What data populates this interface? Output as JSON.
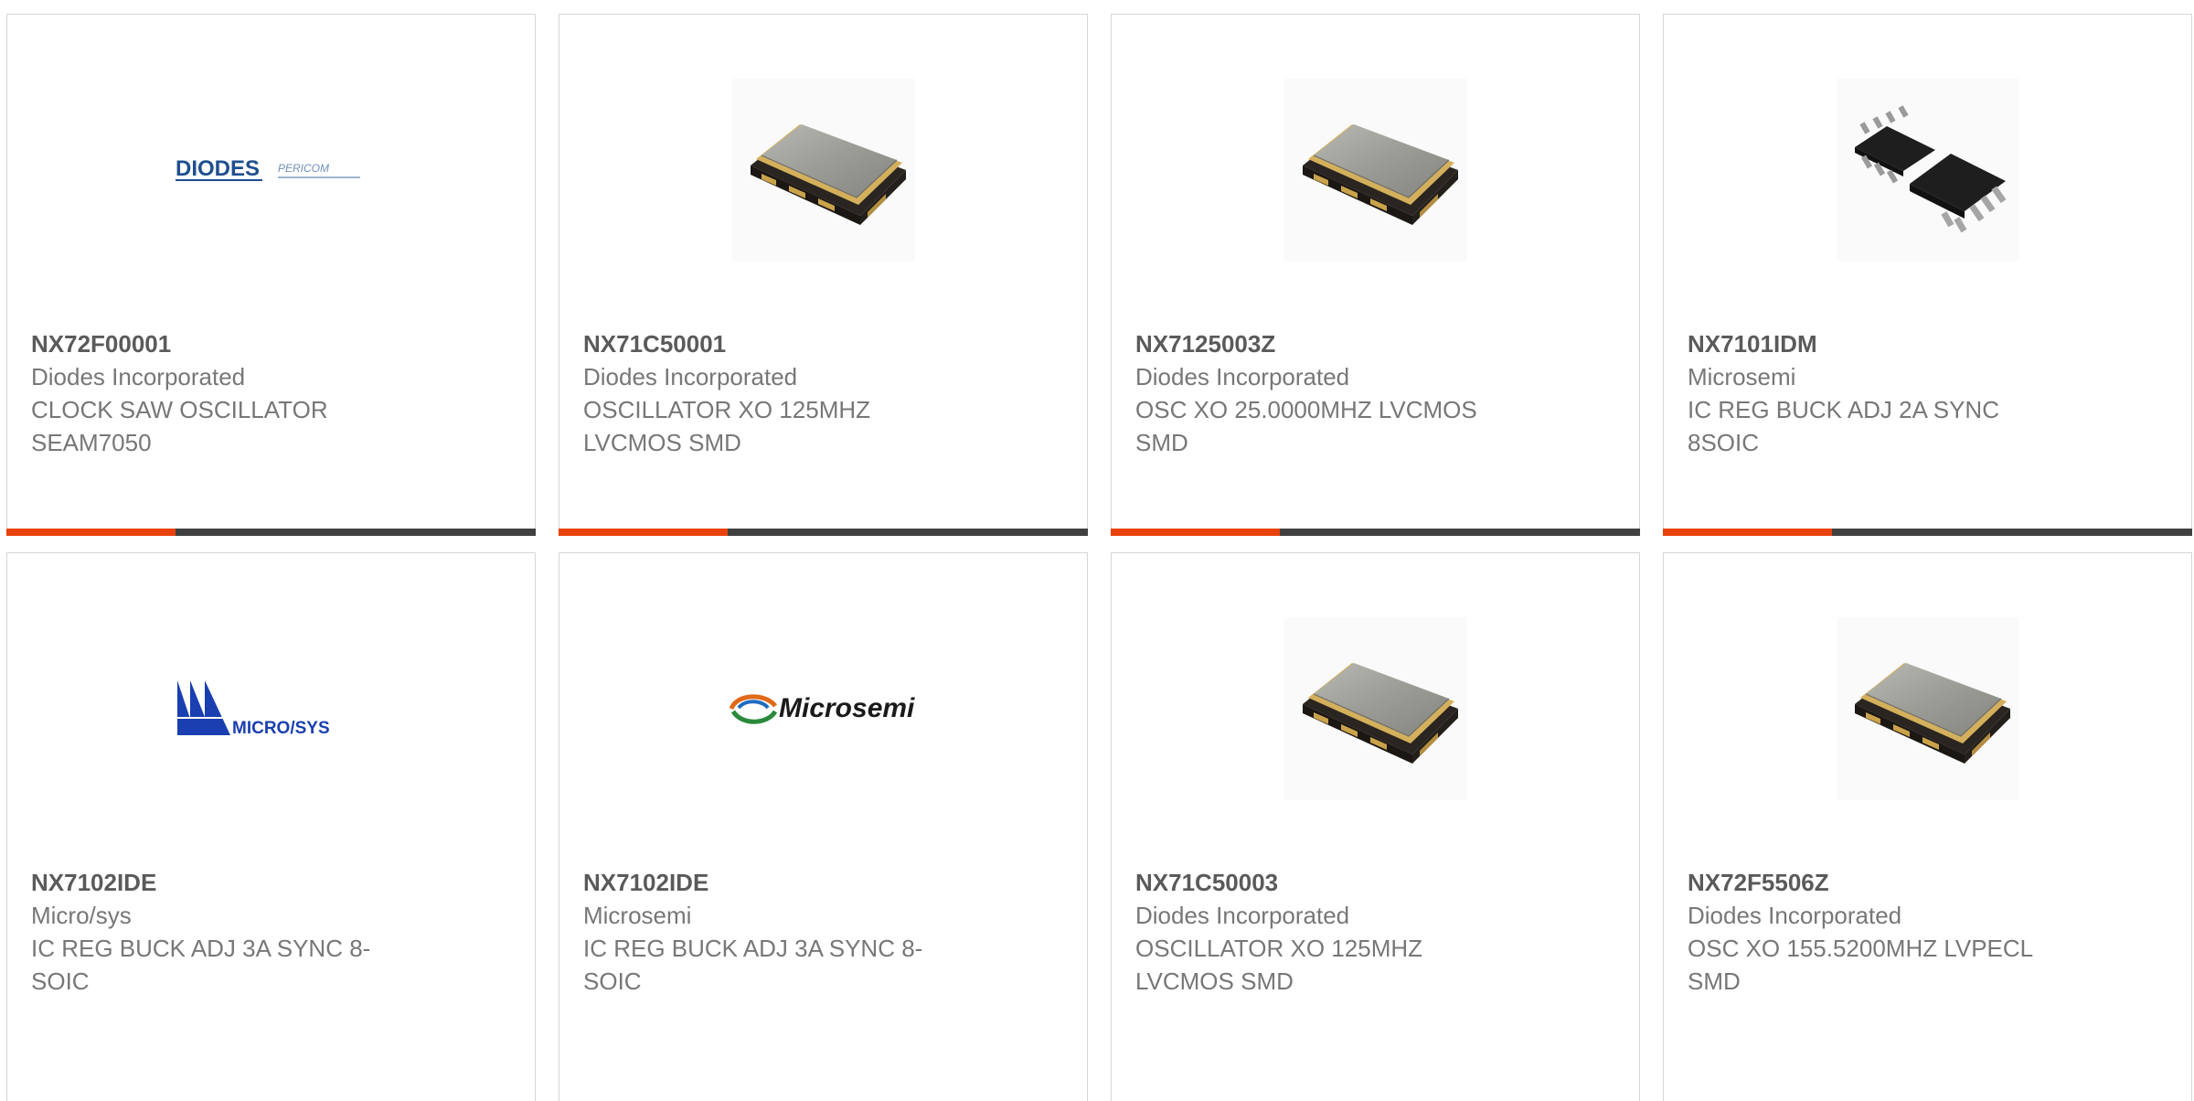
{
  "accent_color": "#e8410c",
  "bar_color": "#404040",
  "cards": [
    {
      "part": "NX72F00001",
      "maker": "Diodes Incorporated",
      "desc_line1": "CLOCK SAW OSCILLATOR",
      "desc_line2": "SEAM7050",
      "image": "diodes-pericom-logo",
      "logo_text_main": "DIODES",
      "logo_text_sub": "PERICOM",
      "progress_fraction": 0.32
    },
    {
      "part": "NX71C50001",
      "maker": "Diodes Incorporated",
      "desc_line1": "OSCILLATOR XO 125MHZ",
      "desc_line2": "LVCMOS SMD",
      "image": "smd-oscillator-photo",
      "progress_fraction": 0.32
    },
    {
      "part": "NX7125003Z",
      "maker": "Diodes Incorporated",
      "desc_line1": "OSC XO 25.0000MHZ LVCMOS",
      "desc_line2": "SMD",
      "image": "smd-oscillator-photo",
      "progress_fraction": 0.32
    },
    {
      "part": "NX7101IDM",
      "maker": "Microsemi",
      "desc_line1": "IC REG BUCK ADJ 2A SYNC",
      "desc_line2": "8SOIC",
      "image": "soic-chip-photo",
      "progress_fraction": 0.32
    },
    {
      "part": "NX7102IDE",
      "maker": "Micro/sys",
      "desc_line1": "IC REG BUCK ADJ 3A SYNC 8-",
      "desc_line2": "SOIC",
      "image": "microsys-logo",
      "logo_text_main": "MICRO/SYS"
    },
    {
      "part": "NX7102IDE",
      "maker": "Microsemi",
      "desc_line1": "IC REG BUCK ADJ 3A SYNC 8-",
      "desc_line2": "SOIC",
      "image": "microsemi-logo",
      "logo_text_main": "Microsemi"
    },
    {
      "part": "NX71C50003",
      "maker": "Diodes Incorporated",
      "desc_line1": "OSCILLATOR XO 125MHZ",
      "desc_line2": "LVCMOS SMD",
      "image": "smd-oscillator-photo"
    },
    {
      "part": "NX72F5506Z",
      "maker": "Diodes Incorporated",
      "desc_line1": "OSC XO 155.5200MHZ LVPECL",
      "desc_line2": "SMD",
      "image": "smd-oscillator-photo"
    }
  ]
}
